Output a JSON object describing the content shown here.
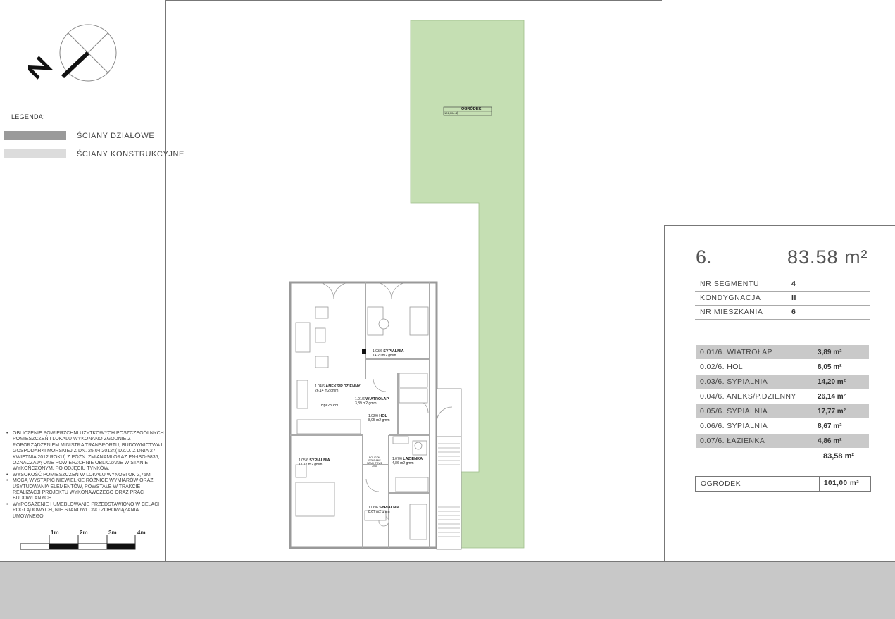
{
  "legend": {
    "title": "LEGENDA:",
    "items": [
      {
        "label": "ŚCIANY DZIAŁOWE",
        "color": "#9a9a9a"
      },
      {
        "label": "ŚCIANY KONSTRUKCYJNE",
        "color": "#dcdcdc"
      }
    ]
  },
  "compass": {
    "letter": "N"
  },
  "notes": [
    "OBLICZENIE POWIERZCHNI UŻYTKOWYCH POSZCZEGÓLNYCH POMIESZCZEŃ I LOKALU WYKONANO ZGODNIE Z ROPORZĄDZENIEM MINISTRA TRANSPORTU, BUDOWNICTWA I GOSPODARKI MORSKIEJ Z DN. 25.04.2012r.( DZ.U. Z DNIA 27 KWIETNIA 2012 ROKU) Z PÓŹN. ZMIANAMI ORAZ PN-ISO-9836, OZNACZAJĄ ONE POWIERZCHNIE OBLICZANE W STANIE WYKOŃCZONYM, PO ODJĘCIU TYNKÓW.",
    "WYSOKOŚĆ POMIESZCZEŃ W LOKALU WYNOSI OK 2,75M.",
    "MOGĄ WYSTĄPIĆ NIEWIELKIE RÓŻNICE WYMIARÓW ORAZ USYTUOWANIA ELEMENTÓW, POWSTAŁE W TRAKCIE REALIZACJI PROJEKTU WYKONAWCZEGO ORAZ PRAC BUDOWLANYCH.",
    "WYPOSAŻENIE I UMEBLOWANIE PRZEDSTAWIONO W CELACH POGLĄDOWYCH, NIE STANOWI ONO ZOBOWIĄZANIA UMOWNEGO."
  ],
  "scale": [
    "1m",
    "2m",
    "3m",
    "4m"
  ],
  "plan": {
    "garden_label": "OGRÓDEK",
    "garden_area": "101,00 m2",
    "garden_color": "#c5dfb3",
    "height_note": "Hp=280cm",
    "duct_note": "POLIGON PODDANE SZACHTOWE 2x40",
    "rooms": [
      {
        "code": "1.03/6",
        "name": "SYPIALNIA",
        "area": "14,20 m2",
        "unit": "gmm"
      },
      {
        "code": "1.04/6",
        "name": "ANEKS/P.DZIENNY",
        "area": "26,14 m2",
        "unit": "gmm"
      },
      {
        "code": "1.01/6",
        "name": "WIATROŁAP",
        "area": "3,89 m2",
        "unit": "gmm"
      },
      {
        "code": "1.02/6",
        "name": "HOL",
        "area": "8,05 m2",
        "unit": "gmm"
      },
      {
        "code": "1.05/6",
        "name": "SYPIALNIA",
        "area": "17,77 m2",
        "unit": "gmm"
      },
      {
        "code": "1.07/6",
        "name": "ŁAZIENKA",
        "area": "4,86 m2",
        "unit": "gmm"
      },
      {
        "code": "1.06/6",
        "name": "SYPIALNIA",
        "area": "8,67 m2",
        "unit": "gmm"
      }
    ]
  },
  "summary": {
    "apartment_no": "6.",
    "total_area": "83.58 m²",
    "info": [
      {
        "key": "NR SEGMENTU",
        "value": "4"
      },
      {
        "key": "KONDYGNACJA",
        "value": "II"
      },
      {
        "key": "NR MIESZKANIA",
        "value": "6"
      }
    ],
    "rooms": [
      {
        "name": "0.01/6. WIATROŁAP",
        "area": "3,89 m²"
      },
      {
        "name": "0.02/6. HOL",
        "area": "8,05 m²"
      },
      {
        "name": "0.03/6. SYPIALNIA",
        "area": "14,20 m²"
      },
      {
        "name": "0.04/6. ANEKS/P.DZIENNY",
        "area": "26,14 m²"
      },
      {
        "name": "0.05/6. SYPIALNIA",
        "area": "17,77 m²"
      },
      {
        "name": "0.06/6. SYPIALNIA",
        "area": "8,67 m²"
      },
      {
        "name": "0.07/6. ŁAZIENKA",
        "area": "4,86 m²"
      }
    ],
    "rooms_total": "83,58 m²",
    "garden": {
      "key": "OGRÓDEK",
      "value": "101,00 m²"
    }
  }
}
